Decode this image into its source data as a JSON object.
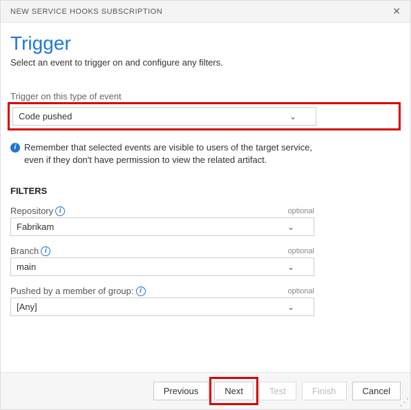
{
  "header": {
    "title": "NEW SERVICE HOOKS SUBSCRIPTION"
  },
  "page": {
    "title": "Trigger",
    "subtitle": "Select an event to trigger on and configure any filters."
  },
  "event": {
    "label": "Trigger on this type of event",
    "value": "Code pushed",
    "note": "Remember that selected events are visible to users of the target service, even if they don't have permission to view the related artifact."
  },
  "filters": {
    "heading": "FILTERS",
    "optional": "optional",
    "repository": {
      "label": "Repository",
      "value": "Fabrikam"
    },
    "branch": {
      "label": "Branch",
      "value": "main"
    },
    "group": {
      "label": "Pushed by a member of group:",
      "value": "[Any]"
    }
  },
  "buttons": {
    "previous": "Previous",
    "next": "Next",
    "test": "Test",
    "finish": "Finish",
    "cancel": "Cancel"
  }
}
